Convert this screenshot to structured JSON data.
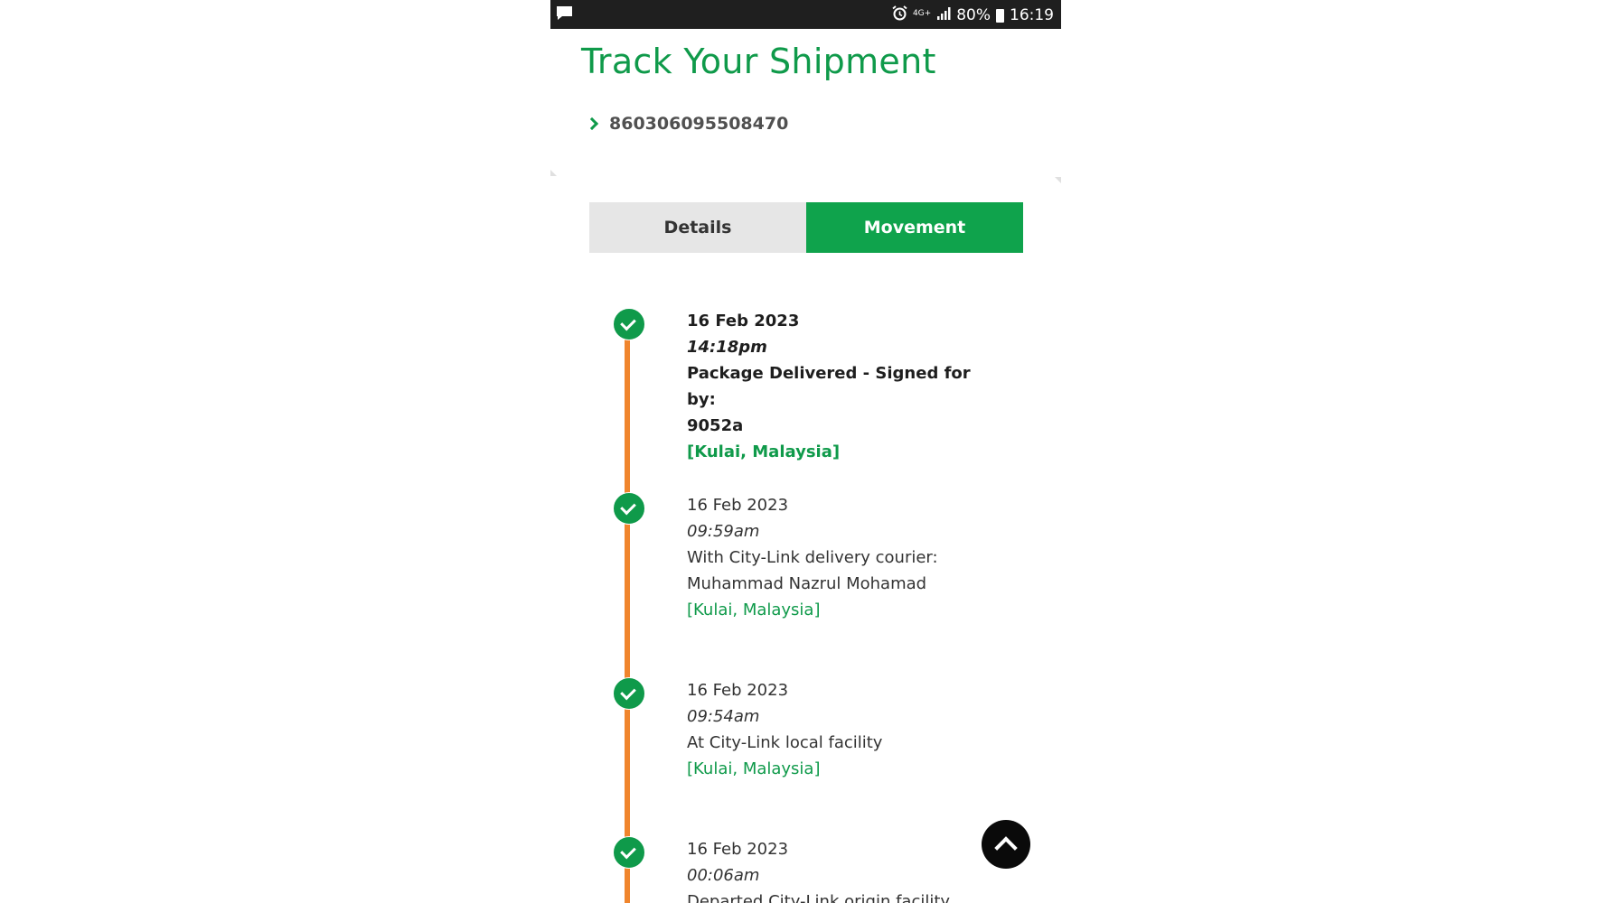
{
  "status_bar": {
    "network": "4G+",
    "battery": "80%",
    "time": "16:19"
  },
  "header": {
    "title": "Track Your Shipment",
    "tracking_number": "860306095508470"
  },
  "tabs": [
    {
      "label": "Details",
      "active": false
    },
    {
      "label": "Movement",
      "active": true
    }
  ],
  "events": [
    {
      "date": "16 Feb 2023",
      "time": "14:18pm",
      "description_line1": "Package Delivered - Signed for by:",
      "description_line2": "9052a",
      "location": "[Kulai, Malaysia]",
      "emphasized": true
    },
    {
      "date": "16 Feb 2023",
      "time": "09:59am",
      "description_line1": "With City-Link delivery courier:",
      "description_line2": "Muhammad Nazrul Mohamad",
      "location": "[Kulai, Malaysia]"
    },
    {
      "date": "16 Feb 2023",
      "time": "09:54am",
      "description_line1": "At City-Link local facility",
      "location": "[Kulai, Malaysia]"
    },
    {
      "date": "16 Feb 2023",
      "time": "00:06am",
      "description_line1": "Departed City-Link origin facility"
    }
  ],
  "colors": {
    "brand_green": "#0f9a4a",
    "timeline_orange": "#f0852d",
    "tab_inactive": "#e6e6e6"
  },
  "icons": {
    "status_left": "message-icon",
    "event_marker": "check-circle-icon",
    "scroll_top": "chevron-up-icon",
    "tracking_bullet": "chevron-right-icon"
  }
}
